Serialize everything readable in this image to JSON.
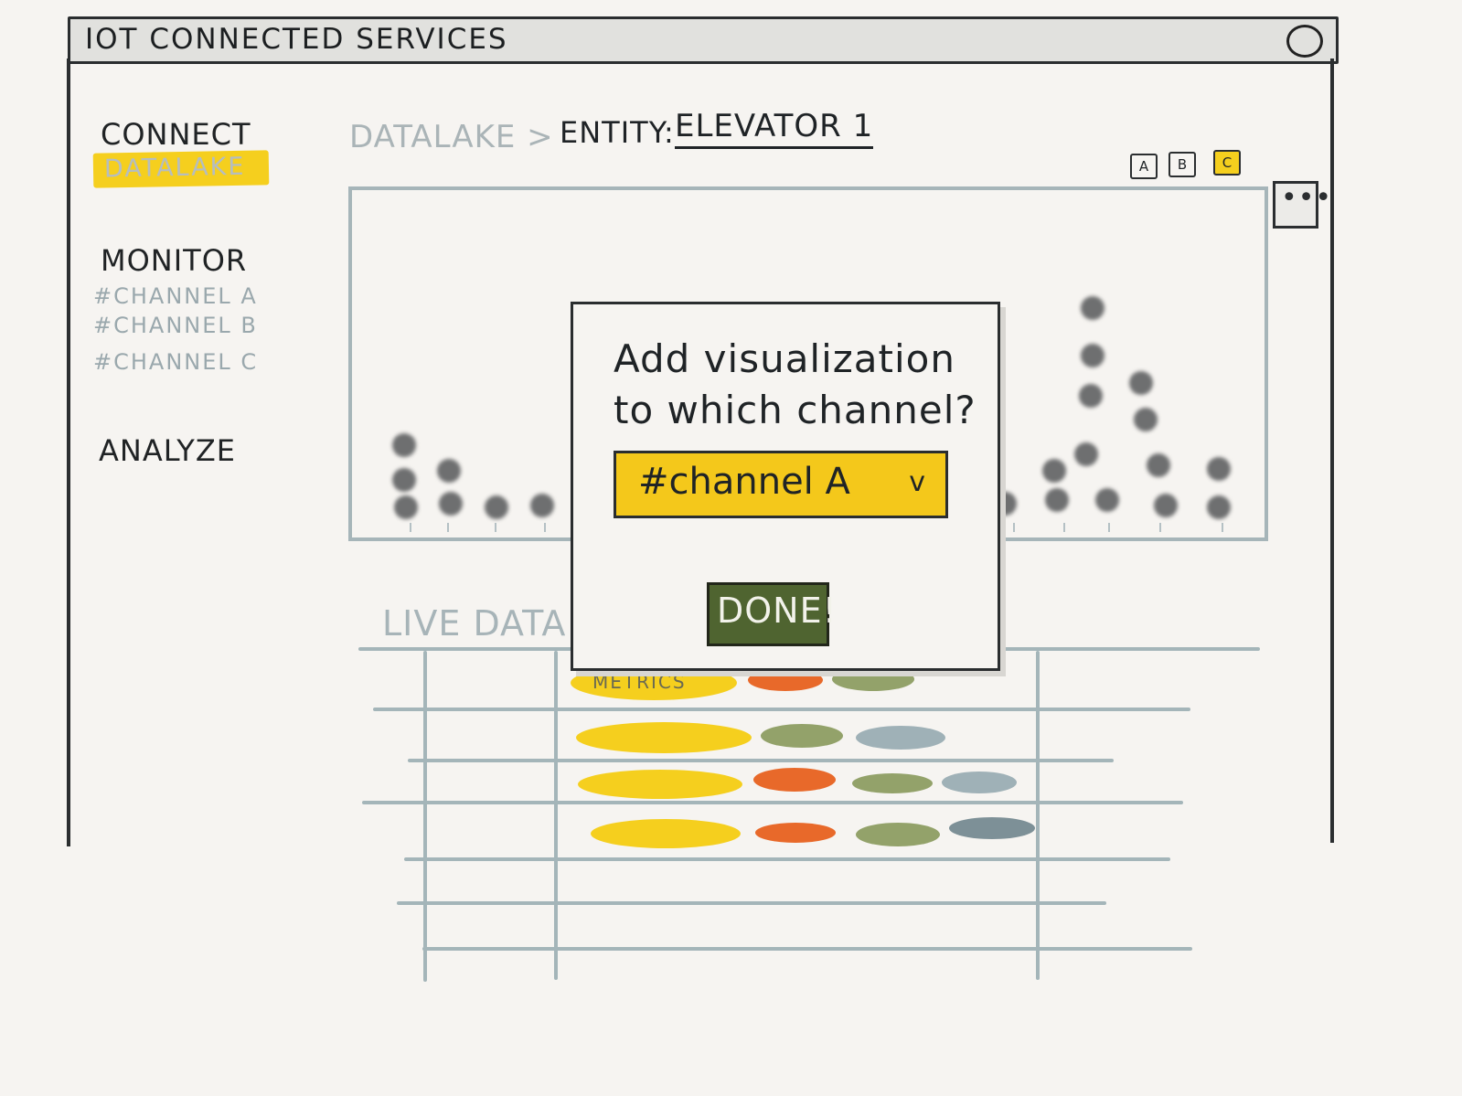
{
  "window": {
    "title": "IOT CONNECTED SERVICES"
  },
  "sidebar": {
    "sections": [
      {
        "label": "CONNECT",
        "items": [
          "DATALAKE"
        ]
      },
      {
        "label": "MONITOR",
        "items": [
          "#CHANNEL A",
          "#CHANNEL B",
          "#CHANNEL C"
        ]
      },
      {
        "label": "ANALYZE",
        "items": []
      }
    ]
  },
  "breadcrumb": {
    "root": "DATALAKE >",
    "entity_label": "ENTITY:",
    "entity_value": "ELEVATOR 1"
  },
  "view_toggles": [
    {
      "label": "A"
    },
    {
      "label": "B"
    },
    {
      "label": "C",
      "active": true
    }
  ],
  "more_button": {
    "label": "•••"
  },
  "live_data": {
    "title": "LIVE DATA",
    "pill_label": "METRICS"
  },
  "modal": {
    "prompt": "Add visualization to which channel?",
    "select_value": "#channel A",
    "select_chevron": "v",
    "done_label": "DONE!"
  },
  "colors": {
    "accent_yellow": "#f5cf1e",
    "orange": "#e8692a",
    "olive": "#93a26a",
    "slate": "#9fb1b7",
    "done_green": "#4f6430"
  }
}
